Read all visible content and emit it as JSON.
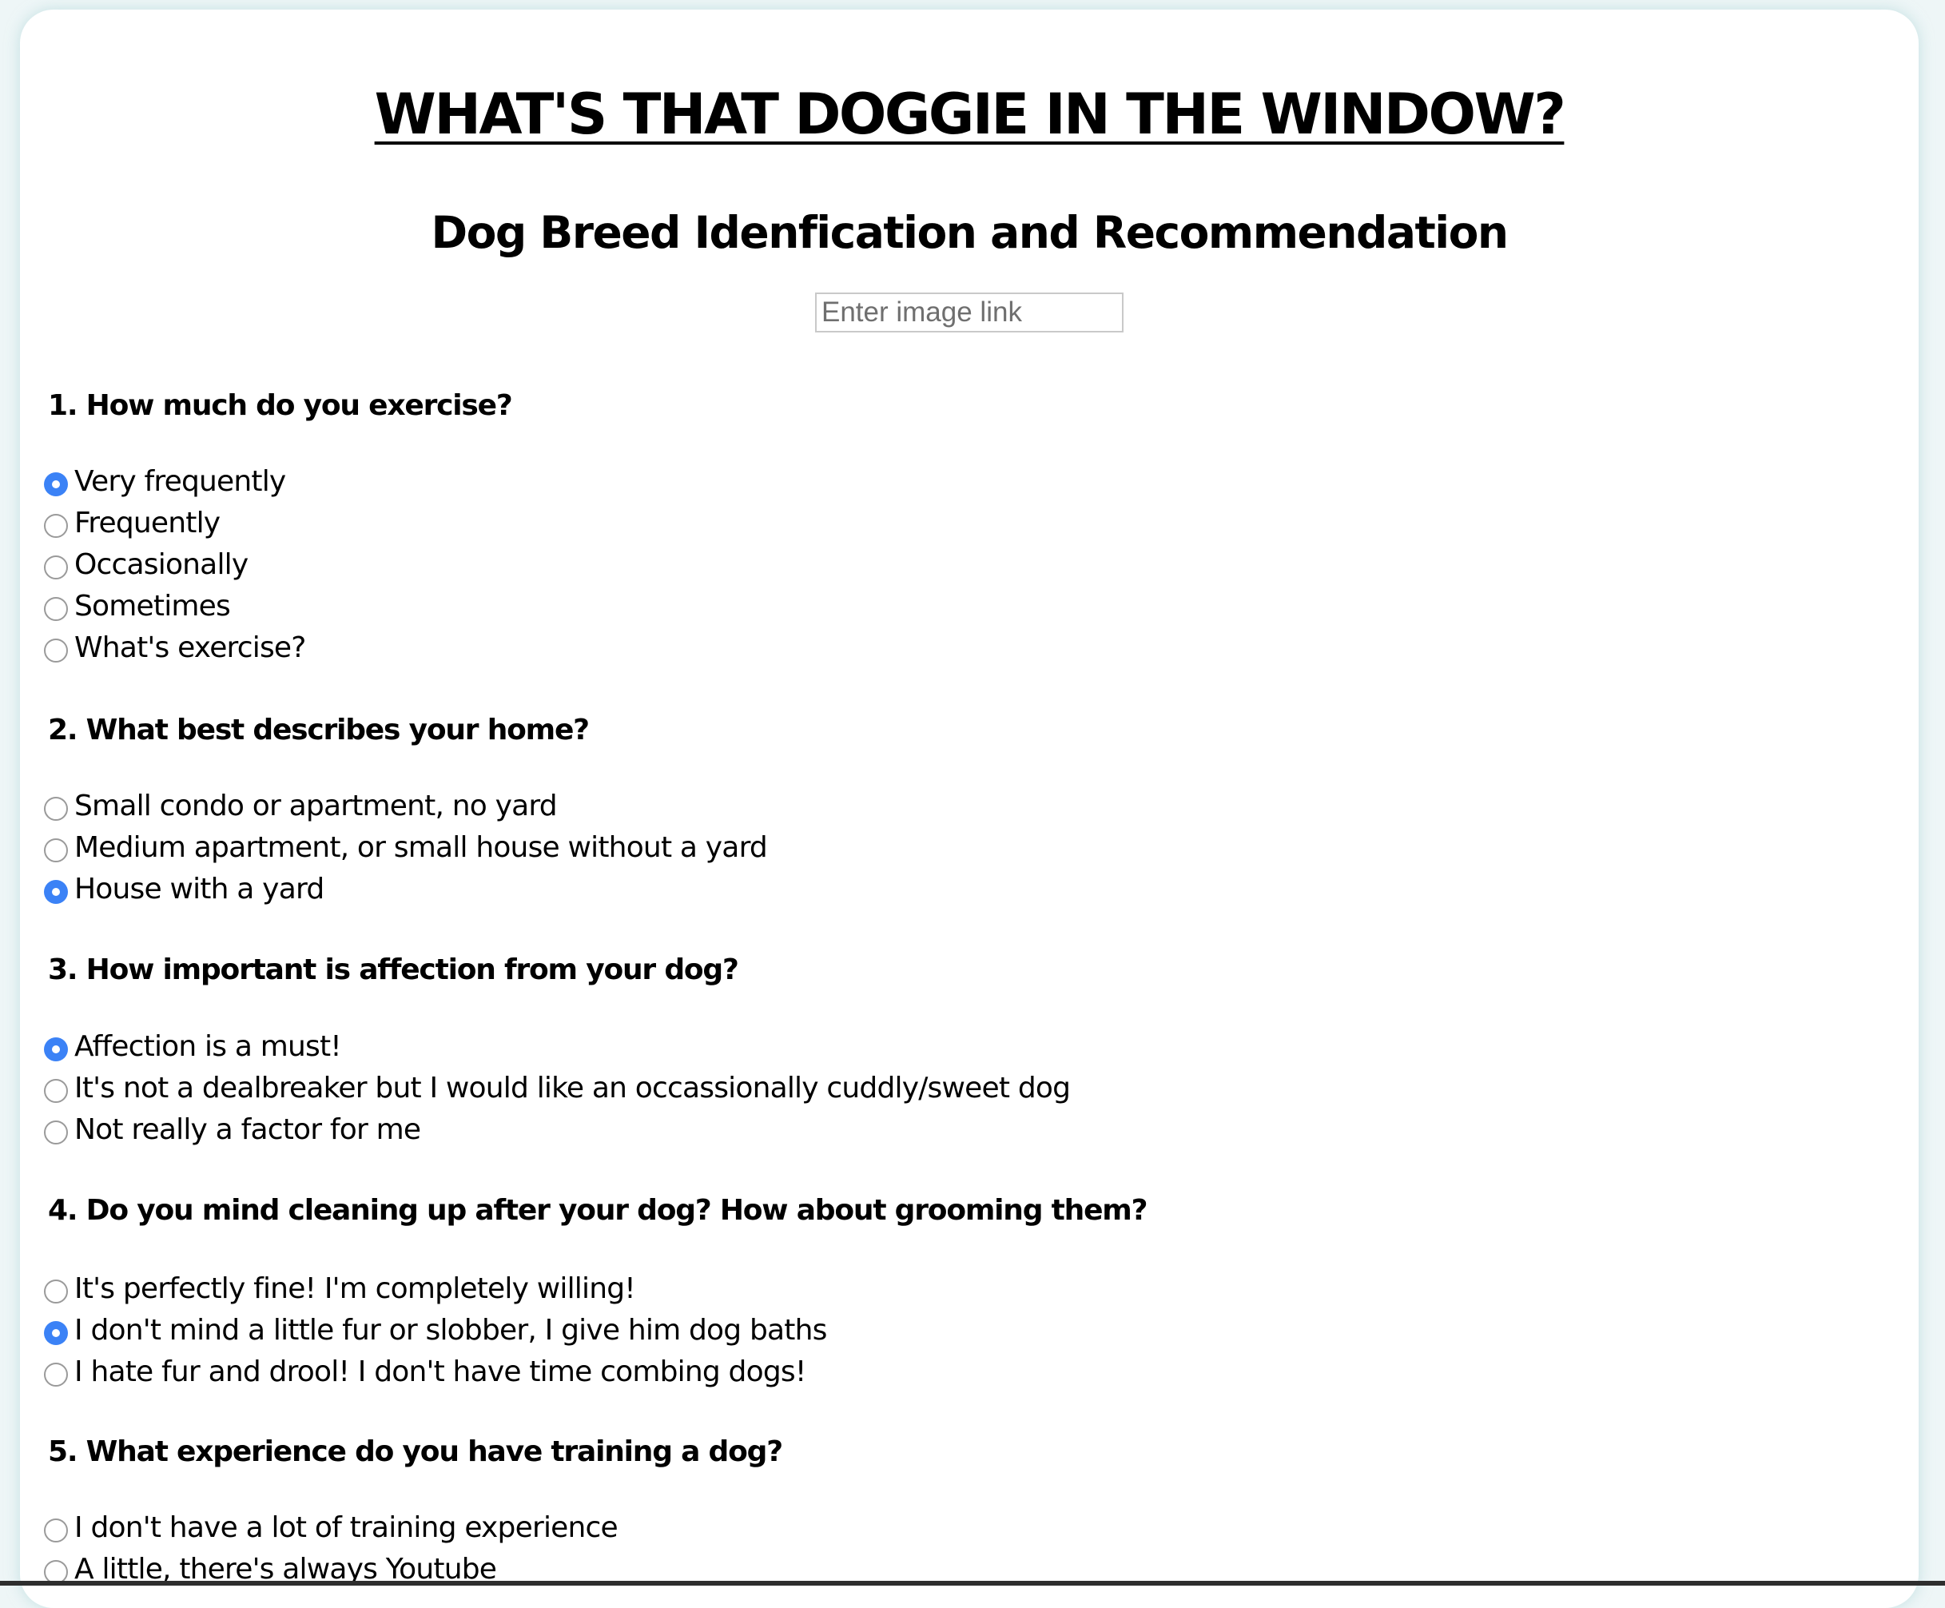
{
  "page": {
    "title": "WHAT'S THAT DOGGIE IN THE WINDOW?",
    "subtitle": "Dog Breed Idenfication and Recommendation",
    "image_input_placeholder": "Enter image link",
    "image_input_value": ""
  },
  "colors": {
    "background": "#eef6f7",
    "card": "#ffffff",
    "radio_checked": "#3b82f6"
  },
  "questions": [
    {
      "label": "1. How much do you exercise?",
      "options": [
        {
          "label": "Very frequently",
          "checked": true
        },
        {
          "label": "Frequently",
          "checked": false
        },
        {
          "label": "Occasionally",
          "checked": false
        },
        {
          "label": "Sometimes",
          "checked": false
        },
        {
          "label": "What's exercise?",
          "checked": false
        }
      ]
    },
    {
      "label": "2. What best describes your home?",
      "options": [
        {
          "label": "Small condo or apartment, no yard",
          "checked": false
        },
        {
          "label": "Medium apartment, or small house without a yard",
          "checked": false
        },
        {
          "label": "House with a yard",
          "checked": true
        }
      ]
    },
    {
      "label": "3. How important is affection from your dog?",
      "options": [
        {
          "label": "Affection is a must!",
          "checked": true
        },
        {
          "label": "It's not a dealbreaker but I would like an occassionally cuddly/sweet dog",
          "checked": false
        },
        {
          "label": "Not really a factor for me",
          "checked": false
        }
      ]
    },
    {
      "label": "4. Do you mind cleaning up after your dog? How about grooming them?",
      "options": [
        {
          "label": "It's perfectly fine! I'm completely willing!",
          "checked": false
        },
        {
          "label": "I don't mind a little fur or slobber, I give him dog baths",
          "checked": true
        },
        {
          "label": "I hate fur and drool! I don't have time combing dogs!",
          "checked": false
        }
      ]
    },
    {
      "label": "5. What experience do you have training a dog?",
      "options": [
        {
          "label": "I don't have a lot of training experience",
          "checked": false
        },
        {
          "label": "A little, there's always Youtube",
          "checked": false
        }
      ]
    }
  ]
}
